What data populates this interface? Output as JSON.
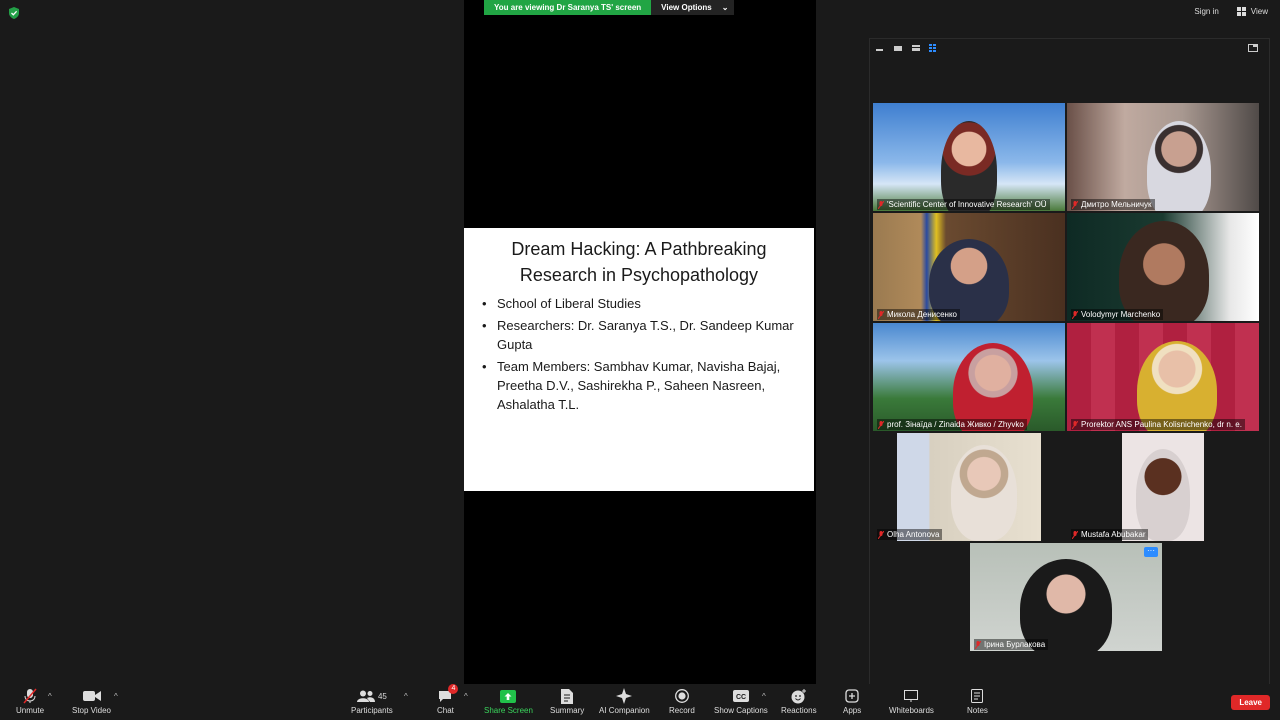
{
  "banner": {
    "message": "You are viewing Dr Saranya TS' screen",
    "options": "View Options"
  },
  "top_right": {
    "sign_in": "Sign in",
    "view": "View"
  },
  "slide": {
    "title": "Dream Hacking: A Pathbreaking Research in Psychopathology",
    "bullets": [
      "School of Liberal Studies",
      "Researchers: Dr. Saranya T.S., Dr. Sandeep Kumar Gupta",
      "Team Members: Sambhav Kumar, Navisha Bajaj, Preetha D.V., Sashirekha P., Saheen Nasreen, Ashalatha T.L."
    ]
  },
  "participants": [
    "'Scientific Center of Innovative Research' OÜ",
    "Дмитро Мельничук",
    "Микола Денисенко",
    "Volodymyr Marchenko",
    "prof. Зінаїда / Zinaida Живко / Zhyvko",
    "Prorektor ANS Paulina Kolisnichenko, dr n. e.",
    "Olha Antonova",
    "Mustafa Abubakar",
    "Ірина  Бурлакова"
  ],
  "toolbar": {
    "unmute": "Unmute",
    "stop_video": "Stop Video",
    "participants": "Participants",
    "participants_count": "45",
    "chat": "Chat",
    "chat_badge": "4",
    "share_screen": "Share Screen",
    "summary": "Summary",
    "ai_companion": "AI Companion",
    "record": "Record",
    "show_captions": "Show Captions",
    "reactions": "Reactions",
    "apps": "Apps",
    "whiteboards": "Whiteboards",
    "notes": "Notes",
    "leave": "Leave"
  },
  "colors": {
    "share_green": "#21a544",
    "leave_red": "#e02828",
    "accent_blue": "#2d8cff"
  }
}
